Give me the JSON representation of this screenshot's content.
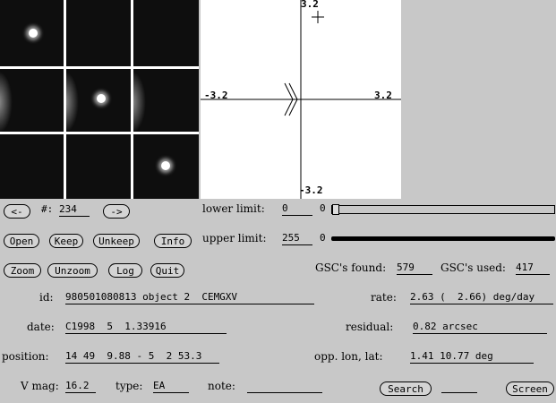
{
  "plot": {
    "ymax_label": "3.2",
    "ymin_label": "-3.2",
    "xmin_label": "-3.2",
    "xmax_label": "3.2"
  },
  "nav": {
    "prev_label": "<-",
    "next_label": "->",
    "number_label": "#:",
    "number_value": "234"
  },
  "buttons": {
    "open": "Open",
    "keep": "Keep",
    "unkeep": "Unkeep",
    "info": "Info",
    "zoom": "Zoom",
    "unzoom": "Unzoom",
    "log": "Log",
    "quit": "Quit",
    "search": "Search",
    "screen": "Screen"
  },
  "limits": {
    "lower_label": "lower limit:",
    "lower_value": "0",
    "lower_slider_value": "0",
    "upper_label": "upper limit:",
    "upper_value": "255",
    "upper_slider_value": "0"
  },
  "gsc": {
    "found_label": "GSC's found:",
    "found_value": "579",
    "used_label": "GSC's used:",
    "used_value": "417"
  },
  "info": {
    "id_label": "id:",
    "id_value": "980501080813 object 2  CEMGXV",
    "date_label": "date:",
    "date_value": "C1998  5  1.33916",
    "position_label": "position:",
    "position_value": "14 49  9.88 - 5  2 53.3",
    "vmag_label": "V mag:",
    "vmag_value": "16.2",
    "type_label": "type:",
    "type_value": "EA",
    "note_label": "note:",
    "note_value": "",
    "rate_label": "rate:",
    "rate_value": "2.63 (  2.66) deg/day",
    "residual_label": "residual:",
    "residual_value": "0.82 arcsec",
    "opp_label": "opp. lon, lat:",
    "opp_value": "1.41 10.77 deg",
    "search_field_value": ""
  }
}
